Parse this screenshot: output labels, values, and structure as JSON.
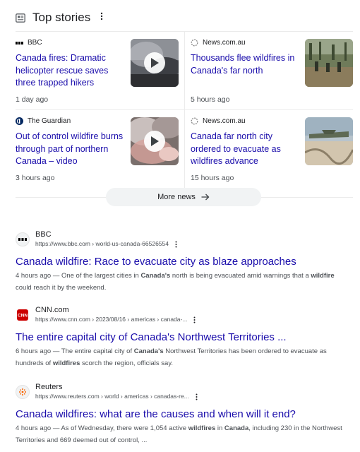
{
  "top_stories": {
    "title": "Top stories",
    "more_news_label": "More news",
    "stories": [
      {
        "source": "BBC",
        "title": "Canada fires: Dramatic helicopter rescue saves three trapped hikers",
        "time": "1 day ago",
        "has_video": true
      },
      {
        "source": "News.com.au",
        "title": "Thousands flee wildfires in Canada's far north",
        "time": "5 hours ago",
        "has_video": false
      },
      {
        "source": "The Guardian",
        "title": "Out of control wildfire burns through part of northern Canada – video",
        "time": "3 hours ago",
        "has_video": true
      },
      {
        "source": "News.com.au",
        "title": "Canada far north city ordered to evacuate as wildfires advance",
        "time": "15 hours ago",
        "has_video": false
      }
    ]
  },
  "results": [
    {
      "site": "BBC",
      "url": "https://www.bbc.com › world-us-canada-66526554",
      "title": "Canada wildfire: Race to evacuate city as blaze approaches",
      "snippet": [
        {
          "t": "4 hours ago — One of the largest cities in "
        },
        {
          "t": "Canada's",
          "b": true
        },
        {
          "t": " north is being evacuated amid warnings that a "
        },
        {
          "t": "wildfire",
          "b": true
        },
        {
          "t": " could reach it by the weekend."
        }
      ]
    },
    {
      "site": "CNN.com",
      "url": "https://www.cnn.com › 2023/08/16 › americas › canada-...",
      "title": "The entire capital city of Canada's Northwest Territories ...",
      "snippet": [
        {
          "t": "6 hours ago — The entire capital city of "
        },
        {
          "t": "Canada's",
          "b": true
        },
        {
          "t": " Northwest Territories has been ordered to evacuate as hundreds of "
        },
        {
          "t": "wildfires",
          "b": true
        },
        {
          "t": " scorch the region, officials say."
        }
      ]
    },
    {
      "site": "Reuters",
      "url": "https://www.reuters.com › world › americas › canadas-re...",
      "title": "Canada wildfires: what are the causes and when will it end?",
      "snippet": [
        {
          "t": "4 hours ago — As of Wednesday, there were 1,054 active "
        },
        {
          "t": "wildfires",
          "b": true
        },
        {
          "t": " in "
        },
        {
          "t": "Canada",
          "b": true
        },
        {
          "t": ", including 230 in the Northwest Territories and 669 deemed out of control, ..."
        }
      ]
    }
  ],
  "colors": {
    "link": "#1a0dab",
    "secondary_text": "#4d5156",
    "divider": "#ebebeb",
    "chip_bg": "#f1f3f4",
    "cnn_red": "#cc0000",
    "reuters_orange": "#fa6400"
  },
  "icons": [
    "news-icon",
    "more-vert-icon",
    "bbc-logo",
    "newscomau-logo",
    "guardian-logo",
    "play-icon",
    "arrow-right-icon",
    "cnn-favicon",
    "reuters-favicon",
    "bbc-favicon"
  ]
}
